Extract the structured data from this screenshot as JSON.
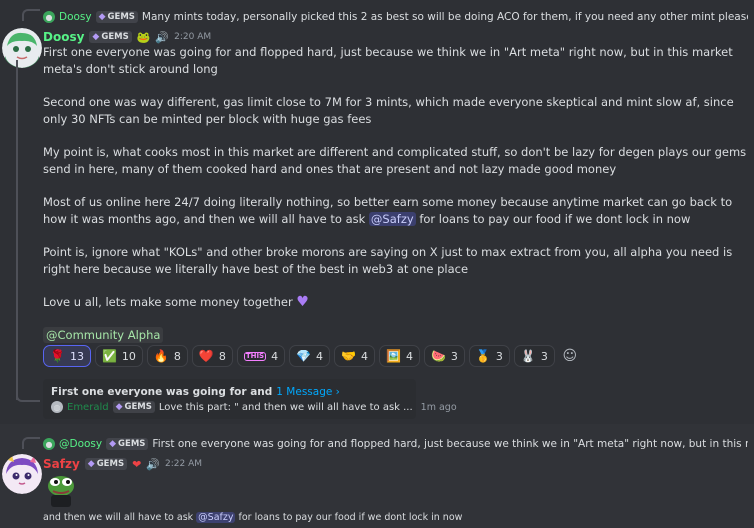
{
  "msg1": {
    "reply": {
      "author": "Doosy",
      "role_label": "GEMS",
      "text": "Many mints today, personally picked this 2 as best so will be doing ACO for them, if you need any other mint please ask in DM but o..."
    },
    "author": "Doosy",
    "role_label": "GEMS",
    "timestamp": "2:20 AM",
    "paragraphs": {
      "p1": "First one everyone was going for and flopped hard, just because we think we in \"Art meta\" right now, but in this market meta's don't stick around long",
      "p2": "Second one was way different, gas limit close to 7M for 3 mints, which made everyone skeptical and mint slow af, since only 30 NFTs can be minted per block with huge gas fees",
      "p3": "My point is, what cooks most in this market are different and complicated stuff, so don't be lazy for degen plays our gems send in here, many of them cooked hard and ones that are present and not lazy made good money",
      "p4a": "Most of us online here 24/7 doing literally nothing, so better earn some money because anytime market can go back to how it was months ago, and then we will all have to ask ",
      "p4_mention": "@Safzy",
      "p4b": " for loans to pay our food if we dont lock in now",
      "p5": "Point is, ignore what \"KOLs\" and other broke morons are saying on X just to max extract from you, all alpha you need is right here because we literally have best of the best in web3 at one place",
      "p6": "Love u all, lets make some money together"
    },
    "role_mention": "@Community Alpha",
    "reactions": [
      {
        "emoji": "🌹",
        "count": "13",
        "name": "rose",
        "me": true
      },
      {
        "emoji": "✅",
        "count": "10",
        "name": "check-mark",
        "me": false
      },
      {
        "emoji": "🔥",
        "count": "8",
        "name": "fire",
        "me": false
      },
      {
        "emoji": "❤️",
        "count": "8",
        "name": "heart",
        "me": false
      },
      {
        "emoji": "THIS",
        "count": "4",
        "name": "this",
        "me": false
      },
      {
        "emoji": "💎",
        "count": "4",
        "name": "gem",
        "me": false
      },
      {
        "emoji": "🤝",
        "count": "4",
        "name": "handshake",
        "me": false
      },
      {
        "emoji": "🖼️",
        "count": "4",
        "name": "pepe-image",
        "me": false
      },
      {
        "emoji": "🍉",
        "count": "3",
        "name": "watermelon",
        "me": false
      },
      {
        "emoji": "🥇",
        "count": "3",
        "name": "gold-medal",
        "me": false
      },
      {
        "emoji": "🐰",
        "count": "3",
        "name": "bunny",
        "me": false
      }
    ],
    "thread": {
      "title": "First one everyone was going for and",
      "link": "1 Message ›",
      "last_author": "Emerald",
      "last_role": "GEMS",
      "last_text": "Love this part: \" and then we will all have to ask ...",
      "last_time": "1m ago"
    }
  },
  "msg2": {
    "reply": {
      "author": "@Doosy",
      "role_label": "GEMS",
      "text": "First one everyone was going for and flopped hard, just because we think we in \"Art meta\" right now, but in this market meta's don't st..."
    },
    "author": "Safzy",
    "role_label": "GEMS",
    "timestamp": "2:22 AM",
    "quote_a": "and then we will all have to ask ",
    "quote_mention": "@Safzy",
    "quote_b": " for loans to pay our food if we dont lock in now"
  },
  "colors": {
    "accent": "#5865f2",
    "author_doosy": "#57f287",
    "author_safzy": "#ed4245",
    "gems_icon": "#b39af5"
  }
}
